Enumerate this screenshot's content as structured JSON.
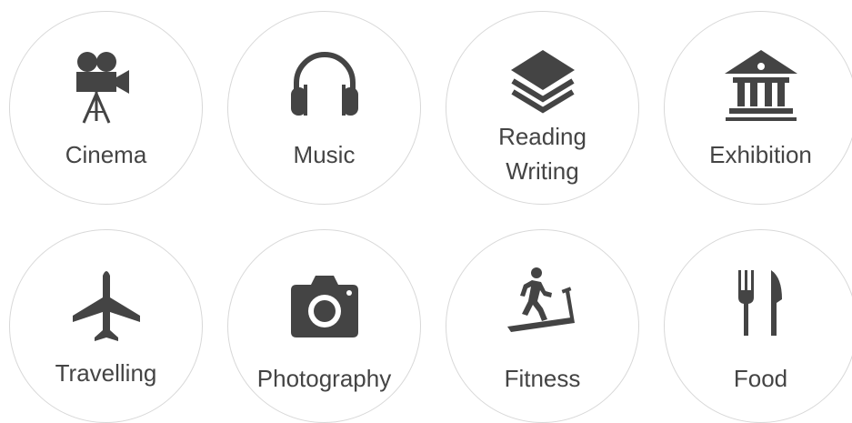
{
  "colors": {
    "icon": "#444444",
    "label": "#444444",
    "circle_border": "#d8d8d8",
    "background": "#ffffff"
  },
  "interests": [
    {
      "label": "Cinema",
      "icon": "movie-camera-icon"
    },
    {
      "label": "Music",
      "icon": "headphones-icon"
    },
    {
      "label_line1": "Reading",
      "label_line2": "Writing",
      "icon": "layers-icon"
    },
    {
      "label": "Exhibition",
      "icon": "museum-icon"
    },
    {
      "label": "Travelling",
      "icon": "airplane-icon"
    },
    {
      "label": "Photography",
      "icon": "camera-icon"
    },
    {
      "label": "Fitness",
      "icon": "treadmill-runner-icon"
    },
    {
      "label": "Food",
      "icon": "fork-knife-icon"
    }
  ]
}
